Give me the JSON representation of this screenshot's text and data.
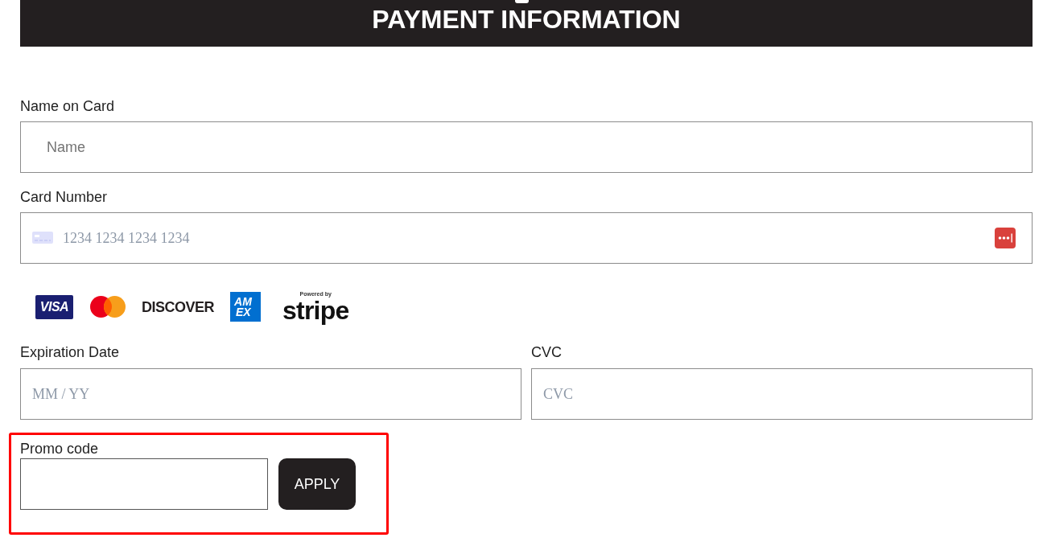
{
  "header": {
    "title": "PAYMENT INFORMATION"
  },
  "name_on_card": {
    "label": "Name on Card",
    "placeholder": "Name"
  },
  "card_number": {
    "label": "Card Number",
    "placeholder": "1234 1234 1234 1234"
  },
  "card_logos": [
    {
      "kind": "visa",
      "text": "VISA"
    },
    {
      "kind": "mastercard"
    },
    {
      "kind": "discover",
      "text": "DISCOVER"
    },
    {
      "kind": "amex",
      "lines": [
        "AM",
        "EX"
      ]
    },
    {
      "kind": "stripe",
      "caption": "Powered by",
      "text": "stripe"
    }
  ],
  "expiration_date": {
    "label": "Expiration Date",
    "placeholder": "MM / YY"
  },
  "cvc": {
    "label": "CVC",
    "placeholder": "CVC"
  },
  "promo_code": {
    "label": "Promo code",
    "button": "APPLY",
    "highlighted": true
  }
}
